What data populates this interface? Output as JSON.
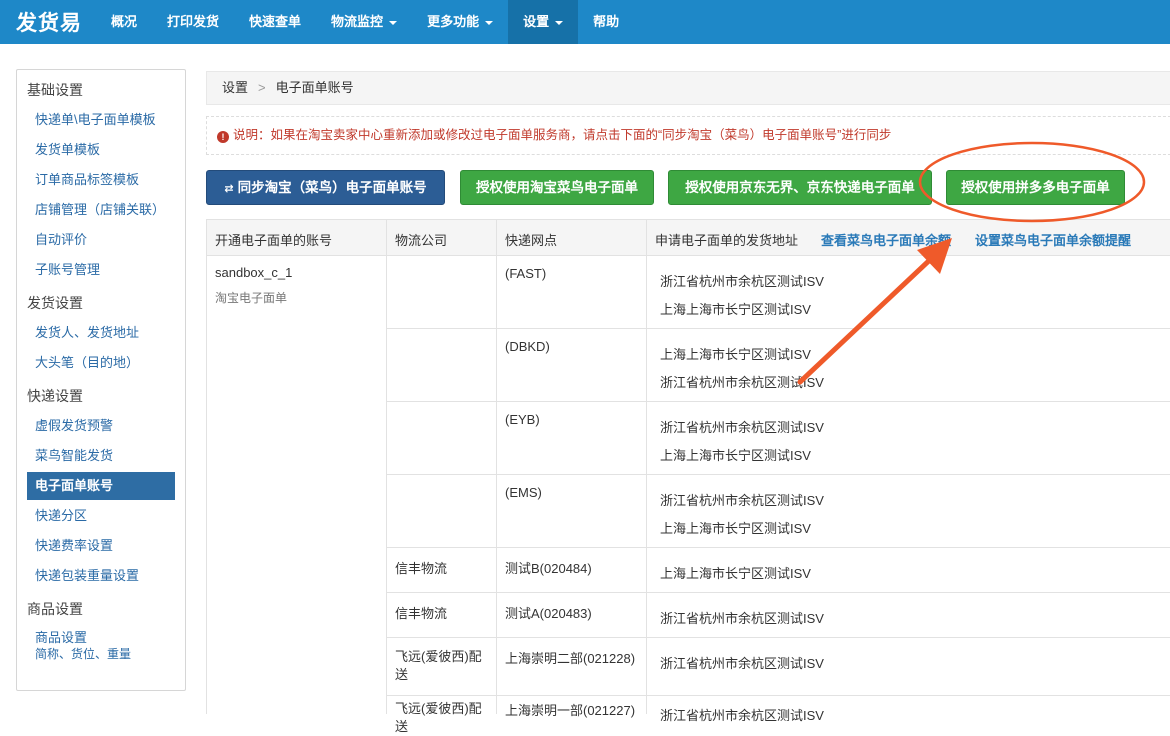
{
  "brand": "发货易",
  "nav": {
    "items": [
      {
        "label": "概况"
      },
      {
        "label": "打印发货"
      },
      {
        "label": "快速查单"
      },
      {
        "label": "物流监控"
      },
      {
        "label": "更多功能"
      },
      {
        "label": "设置"
      },
      {
        "label": "帮助"
      }
    ]
  },
  "sidebar": {
    "sections": {
      "basic": "基础设置",
      "shipping": "发货设置",
      "express": "快递设置",
      "goods": "商品设置"
    },
    "items": [
      "快递单\\电子面单模板",
      "发货单模板",
      "订单商品标签模板",
      "店铺管理（店铺关联）",
      "自动评价",
      "子账号管理",
      "发货人、发货地址",
      "大头笔（目的地）",
      "虚假发货预警",
      "菜鸟智能发货",
      "电子面单账号",
      "快递分区",
      "快递费率设置",
      "快递包装重量设置"
    ],
    "goods_item_line1": "商品设置",
    "goods_item_line2": "简称、货位、重量"
  },
  "breadcrumb": {
    "root": "设置",
    "sep": ">",
    "current": "电子面单账号"
  },
  "notice": {
    "icon": "!",
    "text": "说明：如果在淘宝卖家中心重新添加或修改过电子面单服务商，请点击下面的“同步淘宝（菜鸟）电子面单账号”进行同步"
  },
  "buttons": {
    "sync": "同步淘宝（菜鸟）电子面单账号",
    "auth_taobao": "授权使用淘宝菜鸟电子面单",
    "auth_jd": "授权使用京东无界、京东快递电子面单",
    "auth_pdd": "授权使用拼多多电子面单"
  },
  "table": {
    "headers": {
      "account": "开通电子面单的账号",
      "logistics": "物流公司",
      "branch": "快递网点",
      "address": "申请电子面单的发货地址",
      "view_balance": "查看菜鸟电子面单余额",
      "set_alert": "设置菜鸟电子面单余额提醒"
    },
    "account_name": "sandbox_c_1",
    "account_type": "淘宝电子面单",
    "rows": [
      {
        "logistics": "",
        "branch": "(FAST)",
        "addr1": "浙江省杭州市余杭区测试ISV",
        "addr2": "上海上海市长宁区测试ISV"
      },
      {
        "logistics": "",
        "branch": "(DBKD)",
        "addr1": "上海上海市长宁区测试ISV",
        "addr2": "浙江省杭州市余杭区测试ISV"
      },
      {
        "logistics": "",
        "branch": "(EYB)",
        "addr1": "浙江省杭州市余杭区测试ISV",
        "addr2": "上海上海市长宁区测试ISV"
      },
      {
        "logistics": "",
        "branch": "(EMS)",
        "addr1": "浙江省杭州市余杭区测试ISV",
        "addr2": "上海上海市长宁区测试ISV"
      },
      {
        "logistics": "信丰物流",
        "branch": "测试B(020484)",
        "addr1": "上海上海市长宁区测试ISV",
        "addr2": ""
      },
      {
        "logistics": "信丰物流",
        "branch": "测试A(020483)",
        "addr1": "浙江省杭州市余杭区测试ISV",
        "addr2": ""
      },
      {
        "logistics": "飞远(爱彼西)配送",
        "branch": "上海崇明二部(021228)",
        "addr1": "浙江省杭州市余杭区测试ISV",
        "addr2": ""
      },
      {
        "logistics": "飞远(爱彼西)配送",
        "branch": "上海崇明一部(021227)",
        "addr1": "浙江省杭州市余杭区测试ISV",
        "addr2": ""
      }
    ]
  },
  "colors": {
    "nav_bg": "#1e88c8",
    "nav_active": "#1671a8",
    "sidebar_active": "#2e6da4",
    "btn_blue": "#2c5d95",
    "btn_green": "#3ea743",
    "notice_red": "#c0392b",
    "annotation": "#ef5a2a"
  }
}
